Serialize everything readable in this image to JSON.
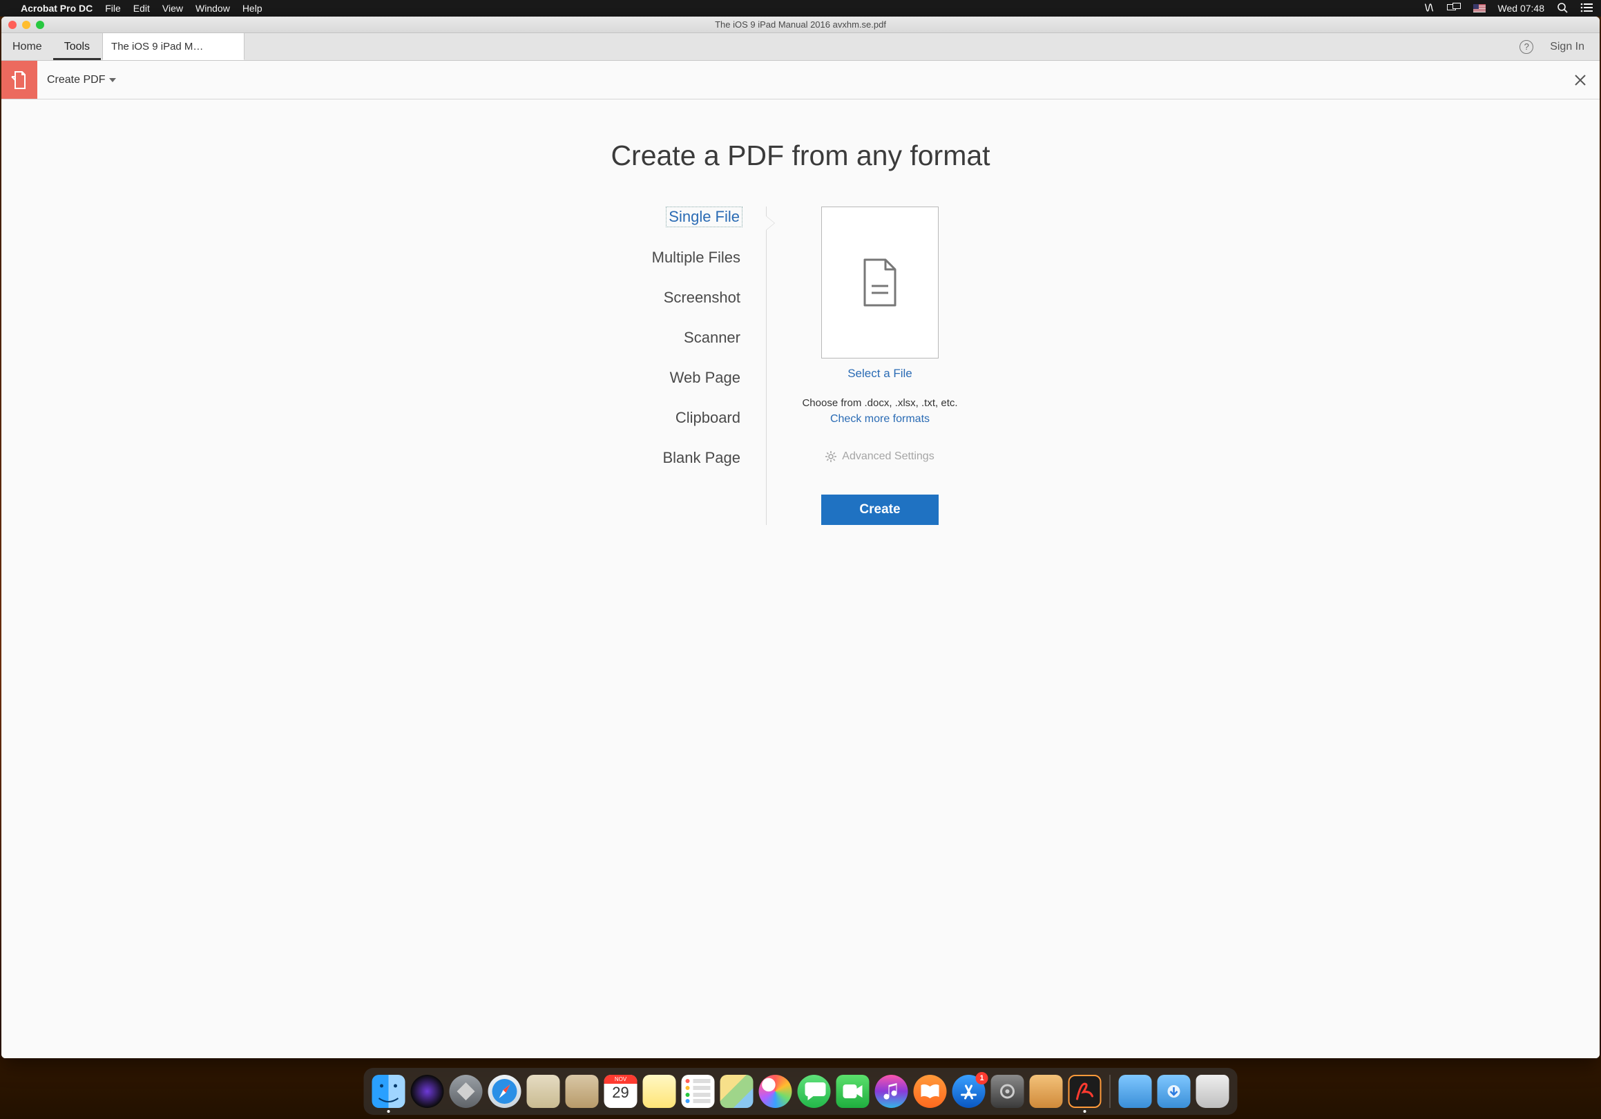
{
  "menubar": {
    "app_name": "Acrobat Pro DC",
    "items": [
      "File",
      "Edit",
      "View",
      "Window",
      "Help"
    ],
    "clock": "Wed 07:48"
  },
  "window": {
    "title": "The iOS 9 iPad Manual 2016 avxhm.se.pdf"
  },
  "tabs": {
    "home": "Home",
    "tools": "Tools",
    "doc": "The iOS 9 iPad M…",
    "sign_in": "Sign In"
  },
  "toolrow": {
    "label": "Create PDF"
  },
  "main": {
    "heading": "Create a PDF from any format",
    "sources": [
      "Single File",
      "Multiple Files",
      "Screenshot",
      "Scanner",
      "Web Page",
      "Clipboard",
      "Blank Page"
    ],
    "selected_source_index": 0,
    "select_file": "Select a File",
    "hint": "Choose from .docx, .xlsx, .txt, etc.",
    "check_more": "Check more formats",
    "advanced": "Advanced Settings",
    "create": "Create"
  },
  "dock": {
    "calendar_month": "NOV",
    "calendar_day": "29",
    "appstore_badge": "1"
  }
}
